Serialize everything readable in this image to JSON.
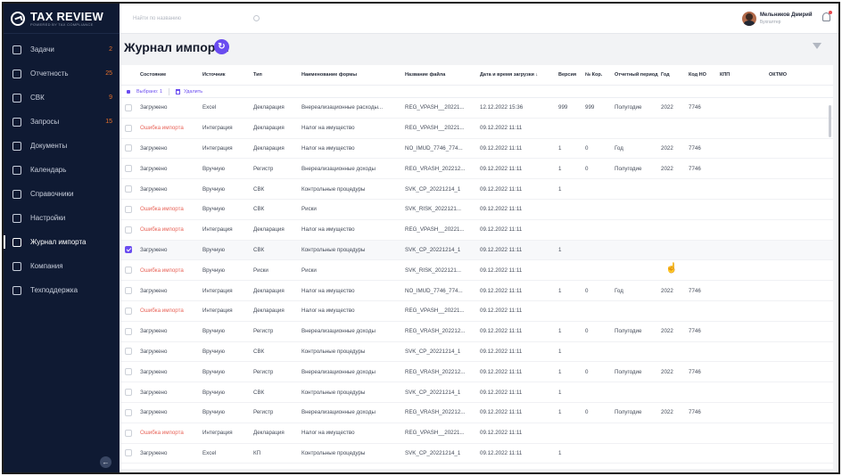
{
  "brand": {
    "title": "TAX REVIEW",
    "subtitle": "POWERED BY TAX COMPLIANCE"
  },
  "sidebar": {
    "items": [
      {
        "label": "Задачи",
        "count": "2",
        "icon": "tasks-icon"
      },
      {
        "label": "Отчетность",
        "count": "25",
        "icon": "reports-icon"
      },
      {
        "label": "СВК",
        "count": "9",
        "icon": "svk-icon"
      },
      {
        "label": "Запросы",
        "count": "15",
        "icon": "requests-icon"
      },
      {
        "label": "Документы",
        "count": "",
        "icon": "documents-icon"
      },
      {
        "label": "Календарь",
        "count": "",
        "icon": "calendar-icon"
      },
      {
        "label": "Справочники",
        "count": "",
        "icon": "book-icon"
      },
      {
        "label": "Настройки",
        "count": "",
        "icon": "gear-icon"
      },
      {
        "label": "Журнал импорта",
        "count": "",
        "icon": "import-log-icon",
        "active": true
      },
      {
        "label": "Компания",
        "count": "",
        "icon": "company-icon"
      },
      {
        "label": "Техподдержка",
        "count": "",
        "icon": "support-icon"
      }
    ]
  },
  "topbar": {
    "search_placeholder": "Найти по названию",
    "user_name": "Мельников Дмирий",
    "user_role": "Бухгалтер"
  },
  "page": {
    "title": "Журнал импорта"
  },
  "table": {
    "headers": [
      "Состояние",
      "Источник",
      "Тип",
      "Наименование формы",
      "Название файла",
      "Дата и время загрузки ↓",
      "Версия",
      "№ Кор.",
      "Отчетный период",
      "Год",
      "Код НО",
      "КПП",
      "ОКТМО"
    ],
    "selection": {
      "selected_label": "Выбрано: 1",
      "delete_label": "Удалить"
    },
    "rows": [
      [
        "Загружено",
        "Excel",
        "Декларация",
        "Внереализационные расходы...",
        "REG_VPASH__20221...",
        "12.12.2022 15:36",
        "999",
        "999",
        "Полугодие",
        "2022",
        "7746",
        "",
        ""
      ],
      [
        "Ошибка импорта",
        "Интеграция",
        "Декларация",
        "Налог на имущество",
        "REG_VPASH__20221...",
        "09.12.2022 11:11",
        "",
        "",
        "",
        "",
        "",
        "",
        ""
      ],
      [
        "Загружено",
        "Интеграция",
        "Декларация",
        "Налог на имущество",
        "NO_IMUD_7746_774...",
        "09.12.2022 11:11",
        "1",
        "0",
        "Год",
        "2022",
        "7746",
        "",
        ""
      ],
      [
        "Загружено",
        "Вручную",
        "Регистр",
        "Внереализационные доходы",
        "REG_VRASH_202212...",
        "09.12.2022 11:11",
        "1",
        "0",
        "Полугодие",
        "2022",
        "7746",
        "",
        ""
      ],
      [
        "Загружено",
        "Вручную",
        "СВК",
        "Контрольные процедуры",
        "SVK_CP_20221214_1",
        "09.12.2022 11:11",
        "1",
        "",
        "",
        "",
        "",
        "",
        ""
      ],
      [
        "Ошибка импорта",
        "Вручную",
        "СВК",
        "Риски",
        "SVK_RISK_2022121...",
        "09.12.2022 11:11",
        "",
        "",
        "",
        "",
        "",
        "",
        ""
      ],
      [
        "Ошибка импорта",
        "Интеграция",
        "Декларация",
        "Налог на имущество",
        "REG_VPASH__20221...",
        "09.12.2022 11:11",
        "",
        "",
        "",
        "",
        "",
        "",
        ""
      ],
      [
        "Загружено",
        "Вручную",
        "СВК",
        "Контрольные процедуры",
        "SVK_CP_20221214_1",
        "09.12.2022 11:11",
        "1",
        "",
        "",
        "",
        "",
        "",
        ""
      ],
      [
        "Ошибка импорта",
        "Вручную",
        "Риски",
        "Риски",
        "SVK_RISK_2022121...",
        "09.12.2022 11:11",
        "",
        "",
        "",
        "",
        "",
        "",
        ""
      ],
      [
        "Загружено",
        "Интеграция",
        "Декларация",
        "Налог на имущество",
        "NO_IMUD_7746_774...",
        "09.12.2022 11:11",
        "1",
        "0",
        "Год",
        "2022",
        "7746",
        "",
        ""
      ],
      [
        "Ошибка импорта",
        "Интеграция",
        "Декларация",
        "Налог на имущество",
        "REG_VPASH__20221...",
        "09.12.2022 11:11",
        "",
        "",
        "",
        "",
        "",
        "",
        ""
      ],
      [
        "Загружено",
        "Вручную",
        "Регистр",
        "Внереализационные доходы",
        "REG_VRASH_202212...",
        "09.12.2022 11:11",
        "1",
        "0",
        "Полугодие",
        "2022",
        "7746",
        "",
        ""
      ],
      [
        "Загружено",
        "Вручную",
        "СВК",
        "Контрольные процедуры",
        "SVK_CP_20221214_1",
        "09.12.2022 11:11",
        "1",
        "",
        "",
        "",
        "",
        "",
        ""
      ],
      [
        "Загружено",
        "Вручную",
        "Регистр",
        "Внереализационные доходы",
        "REG_VRASH_202212...",
        "09.12.2022 11:11",
        "1",
        "0",
        "Полугодие",
        "2022",
        "7746",
        "",
        ""
      ],
      [
        "Загружено",
        "Вручную",
        "СВК",
        "Контрольные процедуры",
        "SVK_CP_20221214_1",
        "09.12.2022 11:11",
        "1",
        "",
        "",
        "",
        "",
        "",
        ""
      ],
      [
        "Загружено",
        "Вручную",
        "Регистр",
        "Внереализационные доходы",
        "REG_VRASH_202212...",
        "09.12.2022 11:11",
        "1",
        "0",
        "Полугодие",
        "2022",
        "7746",
        "",
        ""
      ],
      [
        "Ошибка импорта",
        "Интеграция",
        "Декларация",
        "Налог на имущество",
        "REG_VPASH__20221...",
        "09.12.2022 11:11",
        "",
        "",
        "",
        "",
        "",
        "",
        ""
      ],
      [
        "Загружено",
        "Excel",
        "КП",
        "Контрольные процедуры",
        "SVK_CP_20221214_1",
        "09.12.2022 11:11",
        "1",
        "",
        "",
        "",
        "",
        "",
        ""
      ]
    ],
    "checked_row": 7
  },
  "colors": {
    "accent": "#6a4cf0",
    "error": "#e8655a",
    "sidebar": "#0f1a33",
    "badge": "#e8702a"
  }
}
